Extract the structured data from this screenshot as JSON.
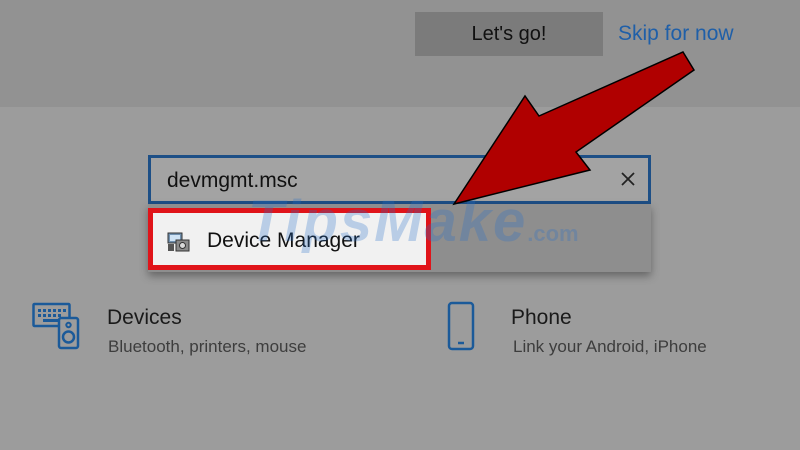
{
  "header": {
    "primary_button_label": "Let's go!",
    "skip_link_label": "Skip for now"
  },
  "search": {
    "value": "devmgmt.msc",
    "clear_icon": "close-icon"
  },
  "search_results": [
    {
      "label": "Device Manager",
      "icon": "device-manager-icon"
    }
  ],
  "watermark": {
    "text": "TipsMake",
    "suffix": ".com"
  },
  "categories": [
    {
      "title": "Devices",
      "subtitle": "Bluetooth, printers, mouse",
      "icon": "devices-icon"
    },
    {
      "title": "Phone",
      "subtitle": "Link your Android, iPhone",
      "icon": "phone-icon"
    }
  ],
  "colors": {
    "highlight_border": "#e0141a",
    "annotation_arrow": "#b00000",
    "search_border": "#1d4f86",
    "link": "#1f5fa8"
  }
}
